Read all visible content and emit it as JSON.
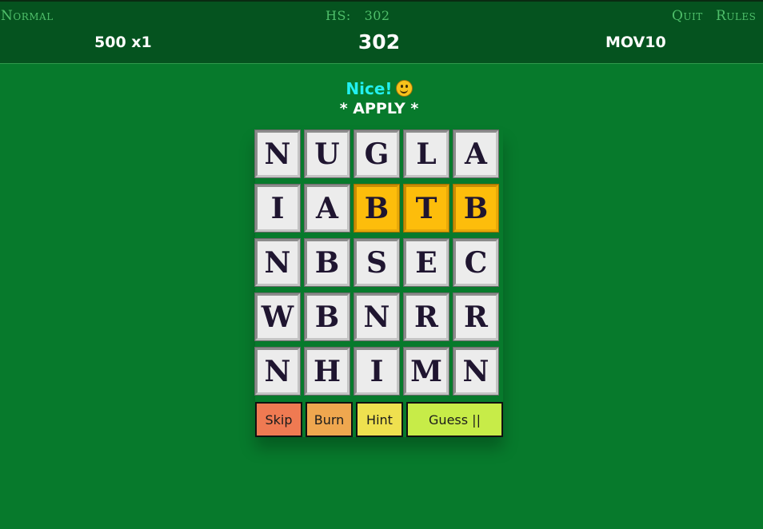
{
  "header": {
    "mode": "Normal",
    "high_score": "HS:   302",
    "quit": "Quit",
    "rules": "Rules",
    "multiplier": "500 x1",
    "score": "302",
    "code": "MOV10"
  },
  "status": {
    "message": "Nice!",
    "word": "* APPLY *"
  },
  "board": {
    "rows": [
      [
        {
          "letter": "N",
          "selected": false
        },
        {
          "letter": "U",
          "selected": false
        },
        {
          "letter": "G",
          "selected": false
        },
        {
          "letter": "L",
          "selected": false
        },
        {
          "letter": "A",
          "selected": false
        }
      ],
      [
        {
          "letter": "I",
          "selected": false
        },
        {
          "letter": "A",
          "selected": false
        },
        {
          "letter": "B",
          "selected": true
        },
        {
          "letter": "T",
          "selected": true
        },
        {
          "letter": "B",
          "selected": true
        }
      ],
      [
        {
          "letter": "N",
          "selected": false
        },
        {
          "letter": "B",
          "selected": false
        },
        {
          "letter": "S",
          "selected": false
        },
        {
          "letter": "E",
          "selected": false
        },
        {
          "letter": "C",
          "selected": false
        }
      ],
      [
        {
          "letter": "W",
          "selected": false
        },
        {
          "letter": "B",
          "selected": false
        },
        {
          "letter": "N",
          "selected": false
        },
        {
          "letter": "R",
          "selected": false
        },
        {
          "letter": "R",
          "selected": false
        }
      ],
      [
        {
          "letter": "N",
          "selected": false
        },
        {
          "letter": "H",
          "selected": false
        },
        {
          "letter": "I",
          "selected": false
        },
        {
          "letter": "M",
          "selected": false
        },
        {
          "letter": "N",
          "selected": false
        }
      ]
    ]
  },
  "actions": {
    "skip": "Skip",
    "burn": "Burn",
    "hint": "Hint",
    "guess": "Guess ||"
  },
  "colors": {
    "background": "#077a2c",
    "header": "#05531f",
    "tile": "#ececec",
    "tile_selected": "#fdbd0b",
    "skip": "#ef7a52",
    "burn": "#efa74f",
    "hint": "#efe04f",
    "guess": "#c7ec48",
    "message": "#22f0f0"
  }
}
